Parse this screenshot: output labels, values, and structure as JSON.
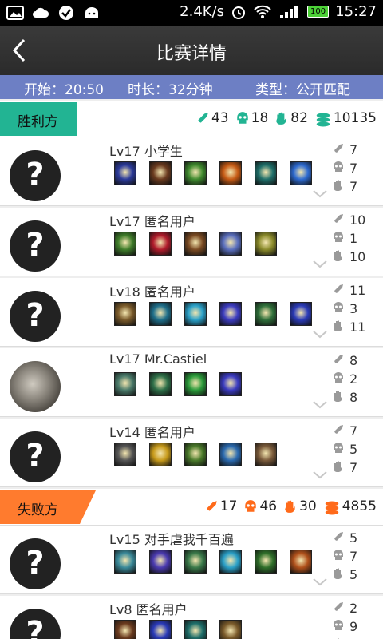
{
  "status_bar": {
    "speed": "2.4K/s",
    "battery": "100",
    "time": "15:27"
  },
  "header": {
    "title": "比赛详情"
  },
  "match_info": {
    "start": "开始：20:50",
    "duration": "时长：32分钟",
    "type": "类型：公开匹配"
  },
  "teams": [
    {
      "label": "胜利方",
      "kills": "43",
      "deaths": "18",
      "assists": "82",
      "gold": "10135",
      "players": [
        {
          "name": "Lv17 小学生",
          "k": "7",
          "d": "7",
          "a": "7",
          "avatar": "question-mark",
          "item_colors": [
            "#2b3a9a",
            "#6a3a1e",
            "#3f8a2e",
            "#c65a14",
            "#1f6f6a",
            "#2d6ad1"
          ]
        },
        {
          "name": "Lv17 匿名用户",
          "k": "10",
          "d": "1",
          "a": "10",
          "avatar": "question-mark",
          "item_colors": [
            "#3f7d2a",
            "#b01b2b",
            "#7a4a22",
            "#5a6fbf",
            "#8a8a2a"
          ]
        },
        {
          "name": "Lv18 匿名用户",
          "k": "11",
          "d": "3",
          "a": "11",
          "avatar": "question-mark",
          "item_colors": [
            "#7a5a2a",
            "#1e6e8a",
            "#2aa0c8",
            "#3b3bc0",
            "#2f6f3a",
            "#2a3ab8"
          ]
        },
        {
          "name": "Lv17 Mr.Castiel",
          "k": "8",
          "d": "2",
          "a": "8",
          "avatar": "photo",
          "item_colors": [
            "#4a7a6a",
            "#2e6f48",
            "#2a9a3a",
            "#3a3ac0"
          ]
        },
        {
          "name": "Lv14 匿名用户",
          "k": "7",
          "d": "5",
          "a": "7",
          "avatar": "question-mark",
          "item_colors": [
            "#555555",
            "#c79a1a",
            "#4a7a2a",
            "#2a6ab0",
            "#7a5a3a"
          ]
        }
      ]
    },
    {
      "label": "失败方",
      "kills": "17",
      "deaths": "46",
      "assists": "30",
      "gold": "4855",
      "players": [
        {
          "name": "Lv15 对手虐我千百遍",
          "k": "5",
          "d": "7",
          "a": "5",
          "avatar": "question-mark",
          "item_colors": [
            "#3a8a9a",
            "#4a3ab0",
            "#3a7a4a",
            "#2aa0c8",
            "#2f6f2a",
            "#b0501a"
          ]
        },
        {
          "name": "Lv8 匿名用户",
          "k": "2",
          "d": "9",
          "a": "",
          "avatar": "question-mark",
          "item_colors": [
            "#6a3a1e",
            "#2a3ab8",
            "#1e6e6a",
            "#7a5a2a"
          ]
        }
      ]
    }
  ],
  "colors": {
    "win": "#22b493",
    "lose": "#ff7b2e",
    "infobar": "#6d7fc4",
    "win_icons": "#22b493",
    "lose_icons": "#ff6a1a"
  }
}
